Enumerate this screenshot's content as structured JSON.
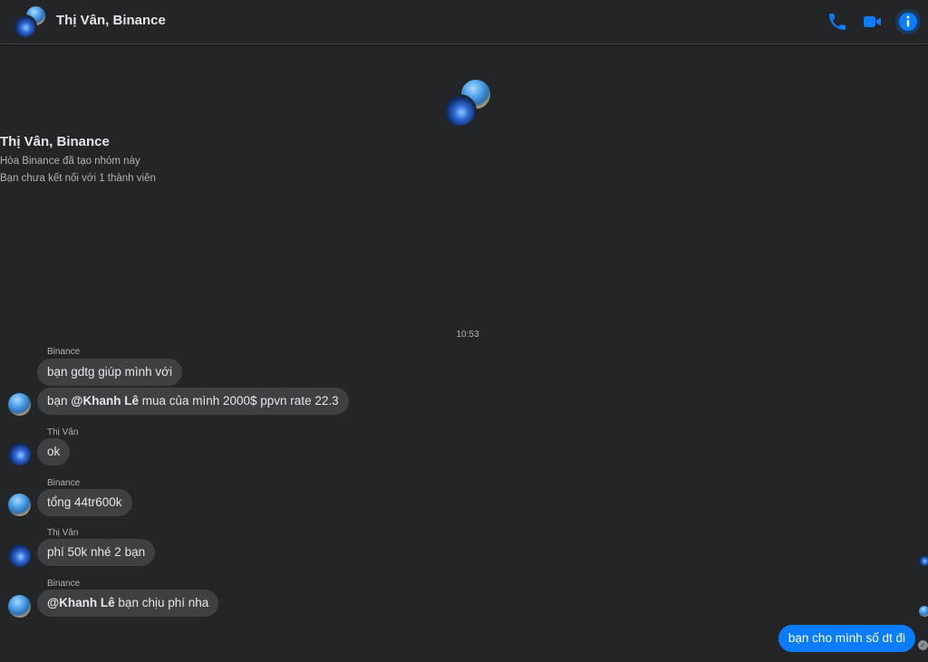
{
  "header": {
    "title": "Thị Vân, Binance",
    "icons": [
      "phone-icon",
      "video-camera-icon",
      "info-icon"
    ],
    "accent": "#0a7cff"
  },
  "intro": {
    "title": "Thị Vân, Binance",
    "created": "Hòa Binance đã tạo nhóm này",
    "connections": "Bạn chưa kết nối với 1 thành viên"
  },
  "timestamp": "10:53",
  "messages": [
    {
      "sender": "Binance",
      "text": "bạn gdtg giúp mình với"
    },
    {
      "pre": "bạn ",
      "mention": "@Khanh Lê",
      "post": " mua của mình 2000$ ppvn rate 22.3"
    },
    {
      "sender": "Thị Vân",
      "text": "ok"
    },
    {
      "sender": "Binance",
      "text": "tổng 44tr600k"
    },
    {
      "sender": "Thị Vân",
      "text": "phí 50k nhé 2 bạn"
    },
    {
      "sender": "Binance",
      "mention": "@Khanh Lê",
      "post": " bạn chịu phí nha"
    }
  ],
  "outgoing": {
    "text": "bạn cho mình số dt đi"
  },
  "colors": {
    "background": "#242526",
    "incoming_bubble": "#3e4042",
    "outgoing_bubble": "#0a7cff",
    "text": "#e4e6eb",
    "muted": "#b0b3b8"
  }
}
